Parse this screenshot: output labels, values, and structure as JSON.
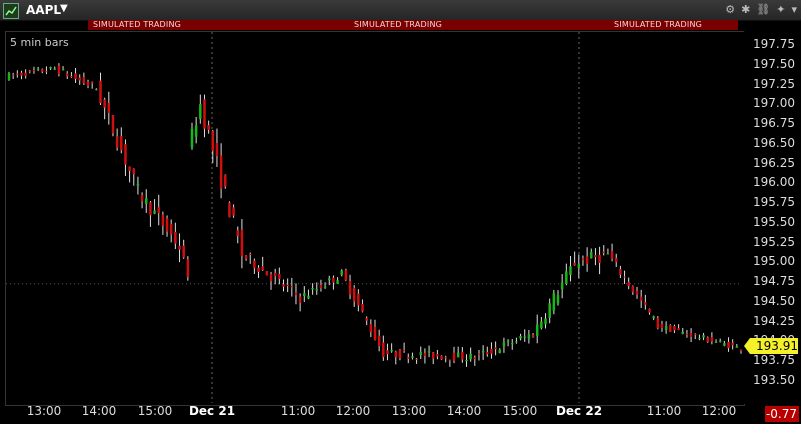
{
  "window": {
    "symbol": "AAPL",
    "sim_labels": [
      "SIMULATED TRADING",
      "SIMULATED TRADING",
      "SIMULATED TRADING"
    ],
    "toolbar_icons": [
      "settings-icon",
      "gear-icon",
      "link-icon",
      "pin-icon",
      "dropdown-icon"
    ]
  },
  "chart_label": "5 min bars",
  "last_price": "193.91",
  "change": "-0.77",
  "colors": {
    "up": "#19b619",
    "down": "#d01010",
    "wick": "#e0e0e0",
    "last_price_bg": "#f4f02a",
    "change_bg": "#b80000",
    "sim_bar": "#7a0000"
  },
  "chart_data": {
    "type": "candlestick",
    "title": "",
    "ylim": [
      193.2,
      197.85
    ],
    "y_ticks": [
      "197.75",
      "197.50",
      "197.25",
      "197.00",
      "196.75",
      "196.50",
      "196.25",
      "196.00",
      "195.75",
      "195.50",
      "195.25",
      "195.00",
      "194.75",
      "194.50",
      "194.25",
      "194.00",
      "193.75",
      "193.50"
    ],
    "x_ticks": [
      {
        "label": "13:00",
        "bold": false
      },
      {
        "label": "14:00",
        "bold": false
      },
      {
        "label": "15:00",
        "bold": false
      },
      {
        "label": "Dec 21",
        "bold": true
      },
      {
        "label": "11:00",
        "bold": false
      },
      {
        "label": "12:00",
        "bold": false
      },
      {
        "label": "13:00",
        "bold": false
      },
      {
        "label": "14:00",
        "bold": false
      },
      {
        "label": "15:00",
        "bold": false
      },
      {
        "label": "Dec 22",
        "bold": true
      },
      {
        "label": "11:00",
        "bold": false
      },
      {
        "label": "12:00",
        "bold": false
      }
    ],
    "day_separators": [
      "Dec 21",
      "Dec 22"
    ],
    "reference_line": 194.73,
    "segments": [
      {
        "from": 197.35,
        "to": 197.45,
        "n": 12,
        "noise": 0.08
      },
      {
        "from": 197.45,
        "to": 197.2,
        "n": 10,
        "noise": 0.1
      },
      {
        "from": 197.2,
        "to": 195.9,
        "n": 10,
        "noise": 0.2
      },
      {
        "from": 195.9,
        "to": 195.2,
        "n": 10,
        "noise": 0.2
      },
      {
        "from": 195.2,
        "to": 194.85,
        "n": 2,
        "noise": 0.1
      },
      {
        "from": 196.4,
        "to": 197.0,
        "n": 3,
        "noise": 0.2
      },
      {
        "from": 197.0,
        "to": 195.1,
        "n": 10,
        "noise": 0.25
      },
      {
        "from": 195.1,
        "to": 194.55,
        "n": 14,
        "noise": 0.15
      },
      {
        "from": 194.55,
        "to": 194.85,
        "n": 10,
        "noise": 0.12
      },
      {
        "from": 194.85,
        "to": 193.85,
        "n": 10,
        "noise": 0.12
      },
      {
        "from": 193.85,
        "to": 193.8,
        "n": 22,
        "noise": 0.12
      },
      {
        "from": 193.8,
        "to": 194.1,
        "n": 14,
        "noise": 0.12
      },
      {
        "from": 194.1,
        "to": 195.0,
        "n": 10,
        "noise": 0.18
      },
      {
        "from": 195.0,
        "to": 195.1,
        "n": 8,
        "noise": 0.18
      },
      {
        "from": 195.1,
        "to": 194.2,
        "n": 12,
        "noise": 0.12
      },
      {
        "from": 194.2,
        "to": 193.91,
        "n": 20,
        "noise": 0.08
      }
    ]
  }
}
